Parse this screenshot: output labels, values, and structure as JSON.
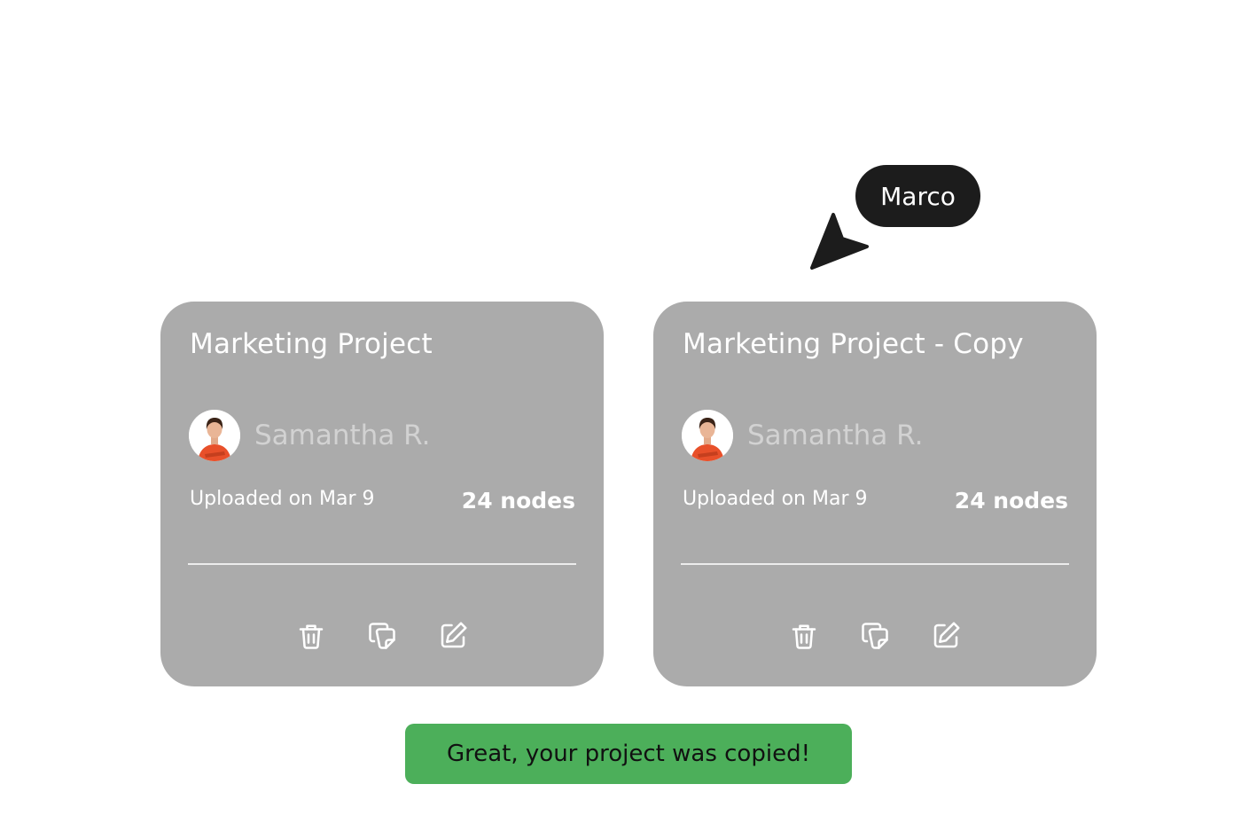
{
  "colors": {
    "card_bg": "#ababab",
    "toast_bg": "#4caf5a",
    "cursor_bg": "#1c1c1c",
    "avatar_shirt": "#e8502a"
  },
  "cursor": {
    "label": "Marco",
    "icon": "pointer-arrow-icon"
  },
  "cards": [
    {
      "title": "Marketing Project",
      "owner": "Samantha R.",
      "uploaded": "Uploaded on Mar 9",
      "nodes": "24 nodes",
      "actions": [
        "trash-icon",
        "copy-icon",
        "edit-icon"
      ]
    },
    {
      "title": "Marketing Project - Copy",
      "owner": "Samantha R.",
      "uploaded": "Uploaded on Mar 9",
      "nodes": "24 nodes",
      "actions": [
        "trash-icon",
        "copy-icon",
        "edit-icon"
      ]
    }
  ],
  "toast": {
    "message": "Great, your project was copied!"
  }
}
